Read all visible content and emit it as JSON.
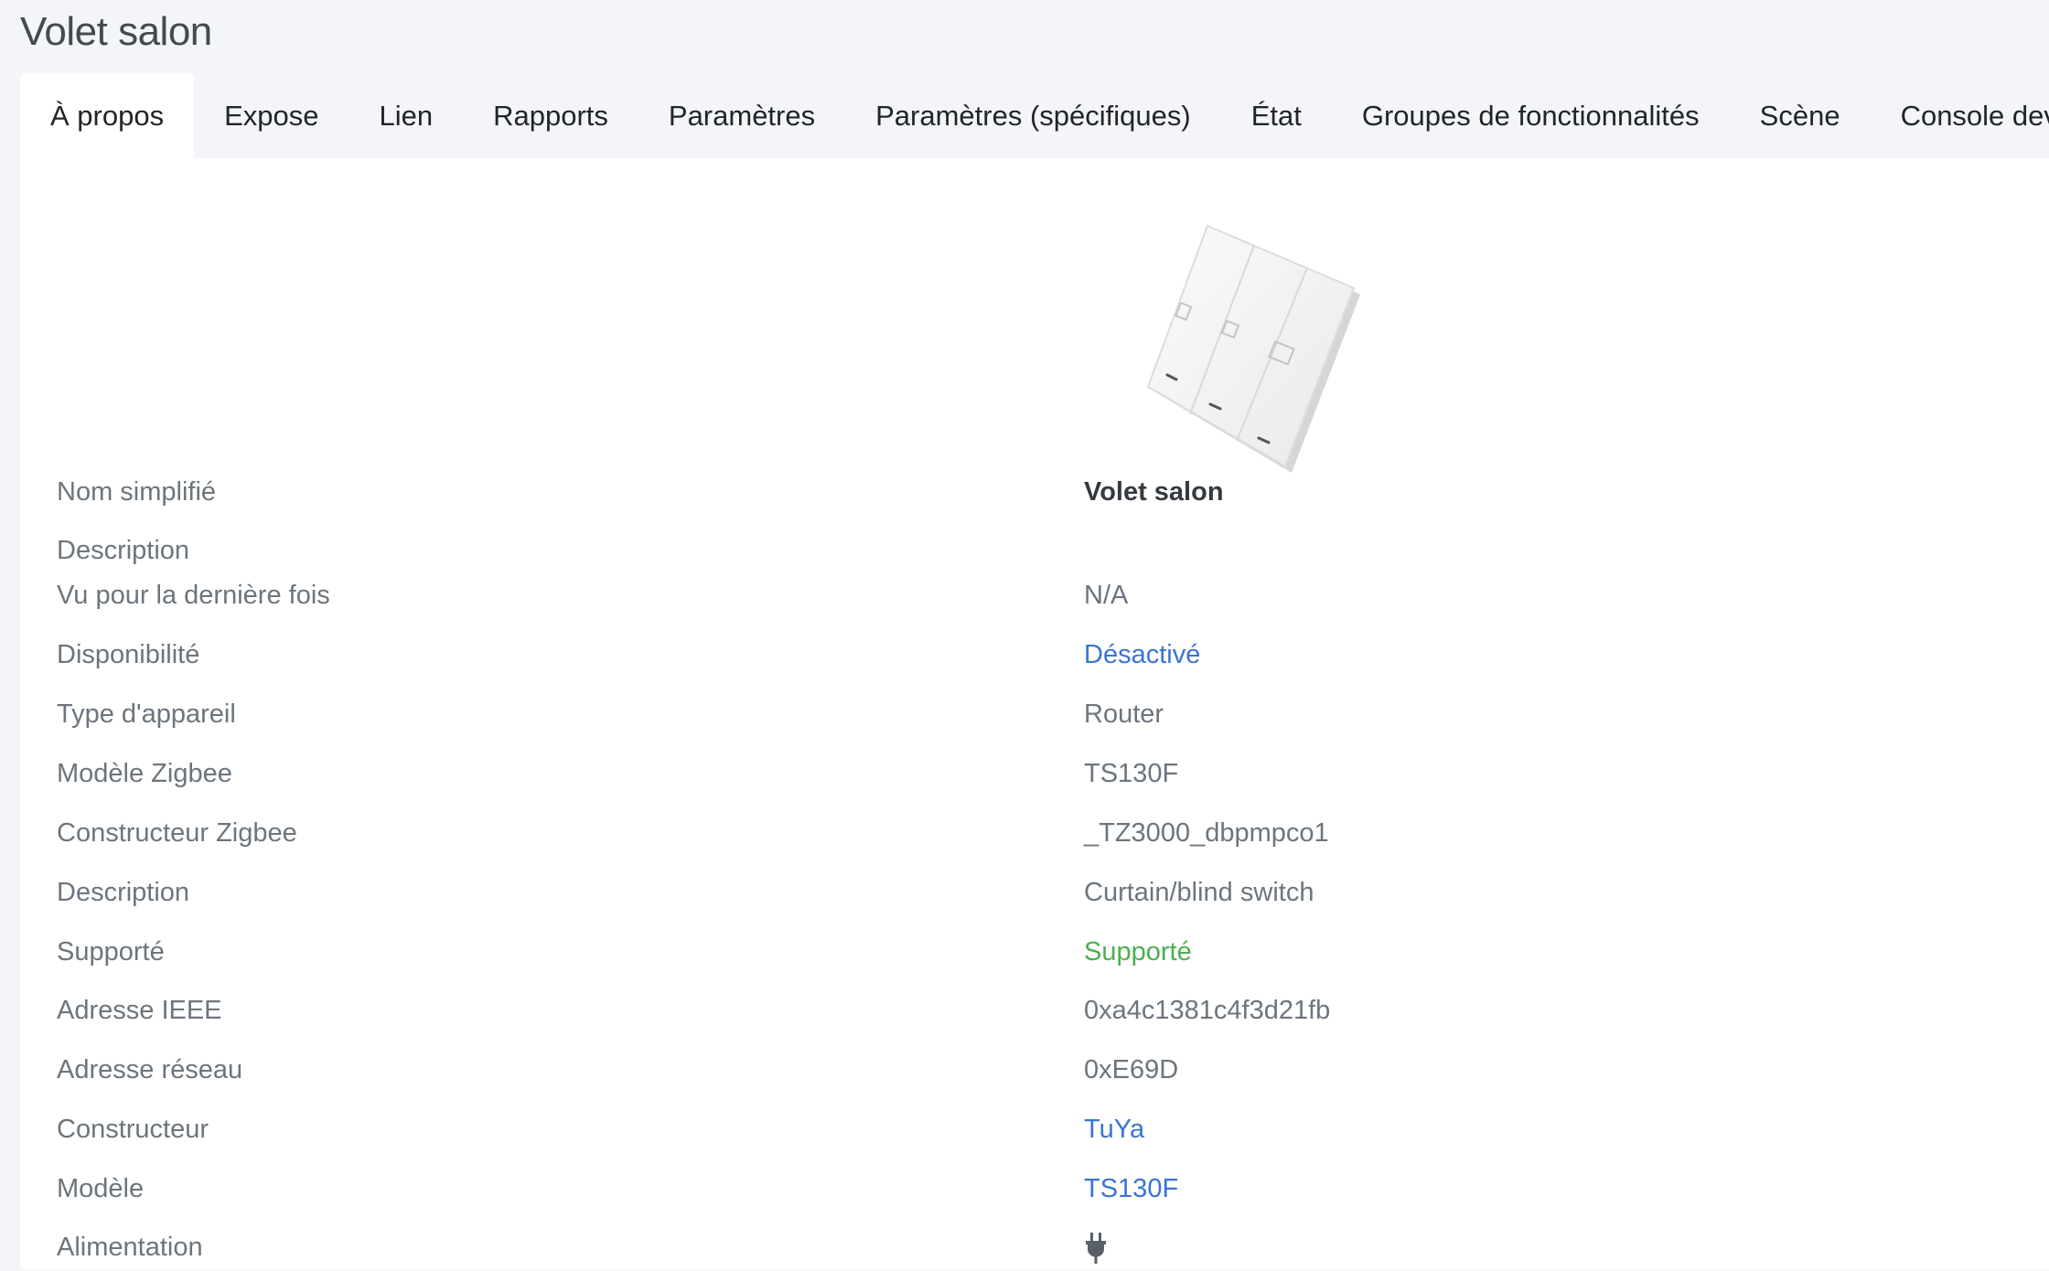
{
  "page": {
    "title": "Volet salon"
  },
  "tabs": [
    {
      "label": "À propos",
      "active": true
    },
    {
      "label": "Expose"
    },
    {
      "label": "Lien"
    },
    {
      "label": "Rapports"
    },
    {
      "label": "Paramètres"
    },
    {
      "label": "Paramètres (spécifiques)"
    },
    {
      "label": "État"
    },
    {
      "label": "Groupes de fonctionnalités"
    },
    {
      "label": "Scène"
    },
    {
      "label": "Console dev"
    }
  ],
  "device": {
    "image_icon": "device-switch-image"
  },
  "info": [
    {
      "label": "Nom simplifié",
      "value": "Volet salon"
    },
    {
      "label": "Description",
      "value": ""
    },
    {
      "label": "Vu pour la dernière fois",
      "value": "N/A"
    },
    {
      "label": "Disponibilité",
      "value": "Désactivé"
    },
    {
      "label": "Type d'appareil",
      "value": "Router"
    },
    {
      "label": "Modèle Zigbee",
      "value": "TS130F"
    },
    {
      "label": "Constructeur Zigbee",
      "value": "_TZ3000_dbpmpco1"
    },
    {
      "label": "Description",
      "value": "Curtain/blind switch"
    },
    {
      "label": "Supporté",
      "value": "Supporté"
    },
    {
      "label": "Adresse IEEE",
      "value": "0xa4c1381c4f3d21fb"
    },
    {
      "label": "Adresse réseau",
      "value": "0xE69D"
    },
    {
      "label": "Constructeur",
      "value": "TuYa"
    },
    {
      "label": "Modèle",
      "value": "TS130F"
    },
    {
      "label": "Alimentation",
      "value_icon": "plug-icon"
    }
  ],
  "colors": {
    "link": "#3a74d4",
    "success": "#4caf50",
    "muted": "#6c757d"
  }
}
